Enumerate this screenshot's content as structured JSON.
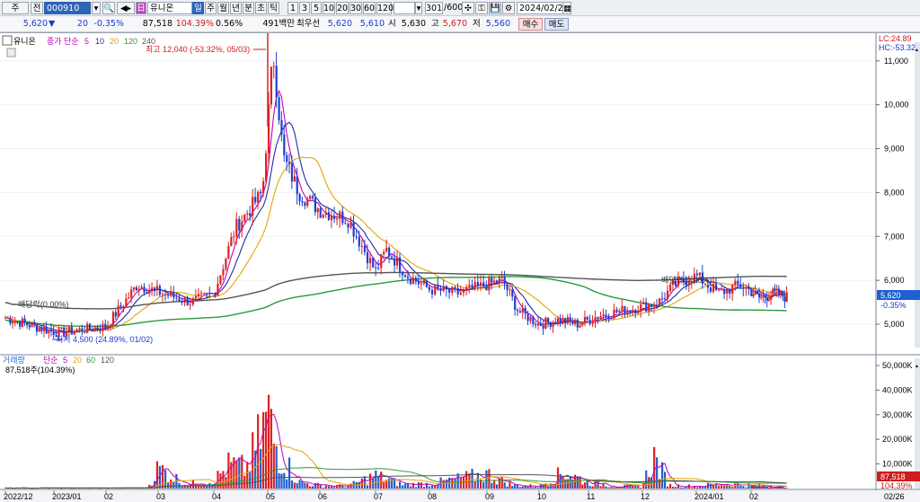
{
  "toolbar": {
    "market": "주",
    "code_prefix": "전",
    "code": "000910",
    "stock_name": "유니온",
    "periods": [
      "일",
      "주",
      "월",
      "년",
      "분",
      "초",
      "틱"
    ],
    "minutes": [
      "1",
      "3",
      "5",
      "10",
      "20",
      "30",
      "60",
      "120"
    ],
    "count_value": "301",
    "count_total": "/600",
    "date": "2024/02/26"
  },
  "quote": {
    "price": "5,620",
    "change": "20",
    "change_rate": "-0.35%",
    "volume": "87,518",
    "vol_ratio": "104.39%",
    "turnover": "0.56%",
    "amount": "491백만",
    "best_label": "최우선",
    "best_ask": "5,620",
    "best_bid": "5,610",
    "open_label": "시",
    "open": "5,630",
    "high_label": "고",
    "high": "5,670",
    "low_label": "저",
    "low": "5,560",
    "buy": "매수",
    "sell": "매도"
  },
  "legend": {
    "name": "유니온",
    "series_label": "종가 단순",
    "periods": [
      "5",
      "10",
      "20",
      "120",
      "240"
    ],
    "colors": [
      "#c000c0",
      "#1f2fa0",
      "#e6a400",
      "#2b9a3b",
      "#555"
    ]
  },
  "price_panel": {
    "lc": "LC:24.89",
    "hc": "HC:-53.32",
    "yticks": [
      "11,000",
      "10,000",
      "9,000",
      "8,000",
      "7,000",
      "6,000",
      "5,000"
    ],
    "current": "5,620",
    "current_rate": "-0.35%",
    "high_label": "최고 12,040 (-53.32%, 05/03)",
    "low_label": "최저 4,500 (24.89%, 01/02)",
    "div_label1": "배당락(0.00%)",
    "div_label2": "배당락(0.00%)"
  },
  "volume_panel": {
    "legend_label": "거래량",
    "series_label": "단순",
    "periods": [
      "5",
      "20",
      "60",
      "120"
    ],
    "colors": [
      "#c000c0",
      "#e6a400",
      "#2b9a3b",
      "#555"
    ],
    "vol_text": "87,518주(104.39%)",
    "yticks": [
      "50,000K",
      "40,000K",
      "30,000K",
      "20,000K",
      "10,000K"
    ],
    "current": "87,518",
    "current_rate": "104.39%"
  },
  "xaxis": {
    "labels": [
      "2022/12",
      "2023/01",
      "02",
      "03",
      "04",
      "05",
      "06",
      "07",
      "08",
      "09",
      "10",
      "11",
      "12",
      "2024/01",
      "02"
    ],
    "right": "02/26"
  },
  "chart_data": {
    "type": "candlestick",
    "y_range": [
      4500,
      12040
    ],
    "price_path": {
      "x_month_index": [
        0,
        0.6,
        1.1,
        1.4,
        2.0,
        2.6,
        3.2,
        3.6,
        4.0,
        4.4,
        4.9,
        5.1,
        5.3,
        5.6,
        6.0,
        6.5,
        7.0,
        7.2,
        7.6,
        8.0,
        8.5,
        9.0,
        9.3,
        9.6,
        10.0,
        10.4,
        10.8,
        11.2,
        11.6,
        12.0,
        12.3,
        12.6,
        13.0,
        13.4,
        13.8,
        14.2,
        14.6,
        14.9
      ],
      "close": [
        5150,
        4950,
        4800,
        4850,
        4950,
        5900,
        5650,
        5500,
        5700,
        7200,
        8000,
        11200,
        8800,
        8000,
        7600,
        7400,
        6200,
        6700,
        6100,
        5800,
        5700,
        5900,
        6000,
        5300,
        5000,
        5100,
        5000,
        5200,
        5300,
        5400,
        5500,
        5900,
        6100,
        5700,
        5900,
        5600,
        5700,
        5620
      ]
    },
    "volume_path": {
      "x_month_index": [
        0,
        1,
        2,
        2.8,
        3,
        3.5,
        4,
        4.3,
        4.6,
        4.9,
        5.0,
        5.1,
        5.3,
        5.6,
        6,
        6.5,
        7,
        7.5,
        8,
        8.5,
        9,
        9.5,
        10,
        10.5,
        11,
        11.5,
        12,
        12.2,
        12.5,
        13,
        13.5,
        14,
        14.5,
        14.9
      ],
      "value": [
        400,
        300,
        300,
        500,
        13000,
        2500,
        5000,
        15000,
        12000,
        35000,
        49000,
        30000,
        18000,
        4000,
        2000,
        1500,
        8000,
        2500,
        3000,
        6000,
        9000,
        2000,
        1500,
        10000,
        4000,
        1500,
        1500,
        20000,
        2000,
        1500,
        3000,
        2000,
        1500,
        1200
      ]
    },
    "series_names": [
      "5",
      "10",
      "20",
      "120",
      "240"
    ]
  }
}
